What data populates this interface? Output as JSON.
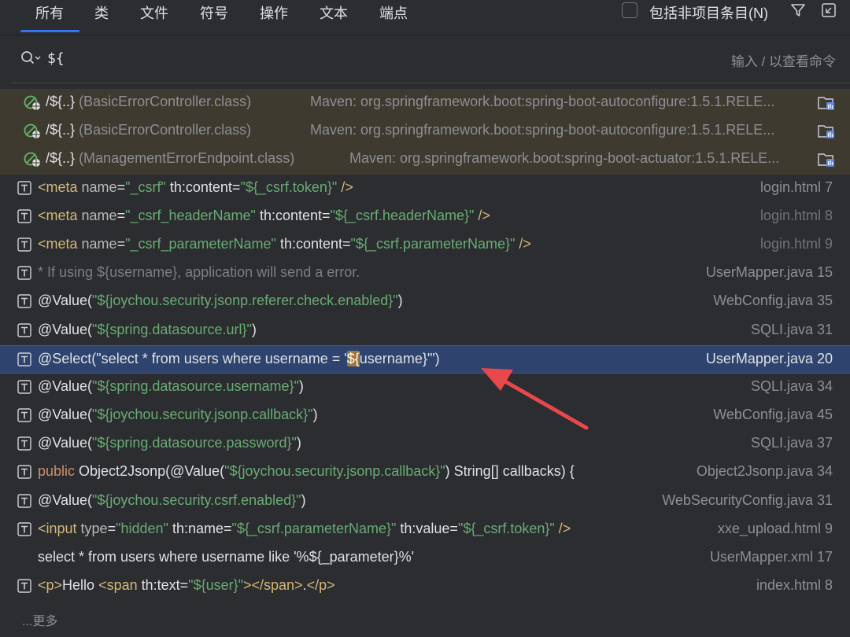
{
  "tabs": [
    "所有",
    "类",
    "文件",
    "符号",
    "操作",
    "文本",
    "端点"
  ],
  "include_non_project": {
    "label": "包括非项目条目(N)",
    "checked": false
  },
  "search": {
    "value": "${",
    "hint": "输入 / 以查看命令"
  },
  "endpoints": [
    {
      "path": "/${..}",
      "class": "(BasicErrorController.class)",
      "source": "Maven: org.springframework.boot:spring-boot-autoconfigure:1.5.1.RELE..."
    },
    {
      "path": "/${..}",
      "class": "(BasicErrorController.class)",
      "source": "Maven: org.springframework.boot:spring-boot-autoconfigure:1.5.1.RELE..."
    },
    {
      "path": "/${..}",
      "class": "(ManagementErrorEndpoint.class)",
      "source": "Maven: org.springframework.boot:spring-boot-actuator:1.5.1.RELE..."
    }
  ],
  "results": [
    {
      "segments": [
        [
          "tag",
          "<meta "
        ],
        [
          "attr",
          "name"
        ],
        [
          "",
          "="
        ],
        [
          "str",
          "\"_csrf\""
        ],
        [
          "",
          " th:content="
        ],
        [
          "str",
          "\"${_csrf.token}\""
        ],
        [
          "tag",
          " />"
        ]
      ],
      "location": "login.html 7",
      "loc_style": ""
    },
    {
      "segments": [
        [
          "tag",
          "<meta "
        ],
        [
          "attr",
          "name"
        ],
        [
          "",
          "="
        ],
        [
          "str",
          "\"_csrf_headerName\""
        ],
        [
          "",
          " th:content="
        ],
        [
          "str",
          "\"${_csrf.headerName}\""
        ],
        [
          "tag",
          " />"
        ]
      ],
      "location": "login.html 8",
      "loc_style": "dim"
    },
    {
      "segments": [
        [
          "tag",
          "<meta "
        ],
        [
          "attr",
          "name"
        ],
        [
          "",
          "="
        ],
        [
          "str",
          "\"_csrf_parameterName\""
        ],
        [
          "",
          " th:content="
        ],
        [
          "str",
          "\"${_csrf.parameterName}\""
        ],
        [
          "tag",
          " />"
        ]
      ],
      "location": "login.html 9",
      "loc_style": "dim"
    },
    {
      "segments": [
        [
          "cmt",
          "* If using ${username}, application will send a error."
        ]
      ],
      "location": "UserMapper.java 15",
      "loc_style": ""
    },
    {
      "segments": [
        [
          "",
          "@Value("
        ],
        [
          "str",
          "\"${joychou.security.jsonp.referer.check.enabled}\""
        ],
        [
          "",
          ")"
        ]
      ],
      "location": "WebConfig.java 35",
      "loc_style": ""
    },
    {
      "segments": [
        [
          "",
          "@Value("
        ],
        [
          "str",
          "\"${spring.datasource.url}\""
        ],
        [
          "",
          ")"
        ]
      ],
      "location": "SQLI.java 31",
      "loc_style": ""
    },
    {
      "segments": [
        [
          "",
          "@Select(\"select * from users where username = '"
        ],
        [
          "hl",
          "${"
        ],
        [
          "",
          "username}'\")"
        ]
      ],
      "location": "UserMapper.java 20",
      "loc_style": "bright",
      "selected": true
    },
    {
      "segments": [
        [
          "",
          "@Value("
        ],
        [
          "str",
          "\"${spring.datasource.username}\""
        ],
        [
          "",
          ")"
        ]
      ],
      "location": "SQLI.java 34",
      "loc_style": ""
    },
    {
      "segments": [
        [
          "",
          "@Value("
        ],
        [
          "str",
          "\"${joychou.security.jsonp.callback}\""
        ],
        [
          "",
          ")"
        ]
      ],
      "location": "WebConfig.java 45",
      "loc_style": ""
    },
    {
      "segments": [
        [
          "",
          "@Value("
        ],
        [
          "str",
          "\"${spring.datasource.password}\""
        ],
        [
          "",
          ")"
        ]
      ],
      "location": "SQLI.java 37",
      "loc_style": ""
    },
    {
      "segments": [
        [
          "kw",
          "public "
        ],
        [
          "",
          "Object2Jsonp(@Value("
        ],
        [
          "str",
          "\"${joychou.security.jsonp.callback}\""
        ],
        [
          "",
          ") String[] callbacks) {"
        ]
      ],
      "location": "Object2Jsonp.java 34",
      "loc_style": ""
    },
    {
      "segments": [
        [
          "",
          "@Value("
        ],
        [
          "str",
          "\"${joychou.security.csrf.enabled}\""
        ],
        [
          "",
          ")"
        ]
      ],
      "location": "WebSecurityConfig.java 31",
      "loc_style": ""
    },
    {
      "segments": [
        [
          "tag",
          "<input "
        ],
        [
          "attr",
          "type"
        ],
        [
          "",
          "="
        ],
        [
          "str",
          "\"hidden\""
        ],
        [
          "",
          " th:name="
        ],
        [
          "str",
          "\"${_csrf.parameterName}\""
        ],
        [
          "",
          " th:value="
        ],
        [
          "str",
          "\"${_csrf.token}\""
        ],
        [
          "tag",
          " />"
        ]
      ],
      "location": "xxe_upload.html 9",
      "loc_style": ""
    },
    {
      "segments": [
        [
          "",
          "select * from users where username like '%${_parameter}%'"
        ]
      ],
      "location": "UserMapper.xml 17",
      "loc_style": "",
      "no_icon": true
    },
    {
      "segments": [
        [
          "tag",
          "<p>"
        ],
        [
          "",
          "Hello "
        ],
        [
          "tag",
          "<span "
        ],
        [
          "",
          "th:text="
        ],
        [
          "str",
          "\"${user}\""
        ],
        [
          "tag",
          "></span>"
        ],
        [
          "",
          "."
        ],
        [
          "tag",
          "</p>"
        ]
      ],
      "location": "index.html 8",
      "loc_style": ""
    }
  ],
  "more_label": "...更多",
  "colors": {
    "background": "#2b2d30",
    "selected": "#2e436e",
    "endpoint_row": "#3f3a30",
    "accent": "#3574f0",
    "arrow": "#e8474c"
  }
}
